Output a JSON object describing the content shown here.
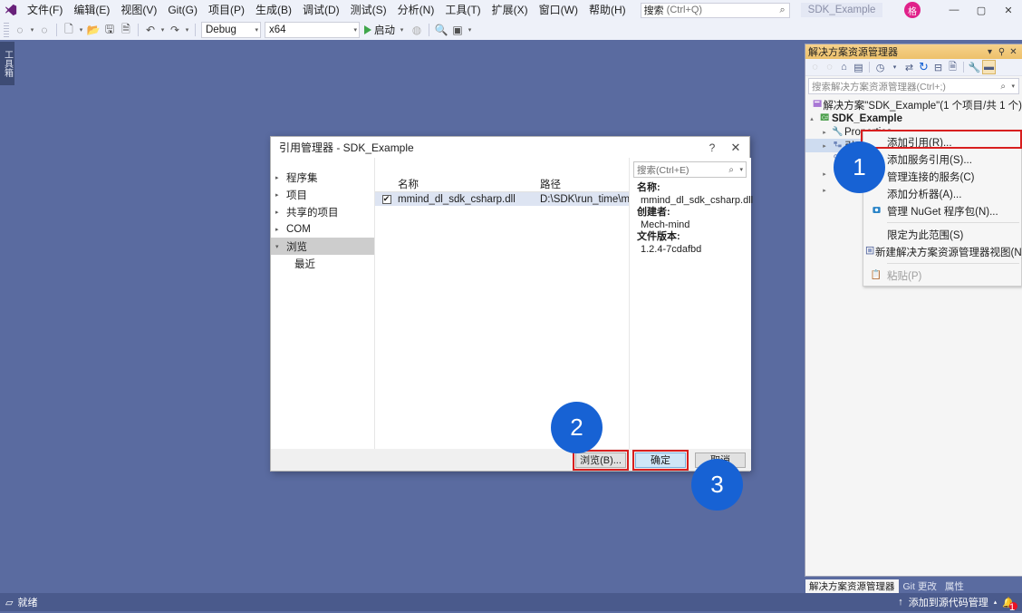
{
  "app": {
    "logo": "vs-logo",
    "menus": [
      "文件(F)",
      "编辑(E)",
      "视图(V)",
      "Git(G)",
      "项目(P)",
      "生成(B)",
      "调试(D)",
      "测试(S)",
      "分析(N)",
      "工具(T)",
      "扩展(X)",
      "窗口(W)",
      "帮助(H)"
    ],
    "quick_search": {
      "label": "搜索",
      "hint": "(Ctrl+Q)"
    },
    "project_chip": "SDK_Example",
    "account_initial": "格",
    "window_buttons": {
      "minimize": "—",
      "maximize": "▢",
      "close": "✕"
    }
  },
  "toolbar": {
    "config": {
      "value": "Debug"
    },
    "platform": {
      "value": "x64"
    },
    "run_label": "启动"
  },
  "toolbox_tab": "工具箱",
  "solution_explorer": {
    "title": "解决方案资源管理器",
    "title_buttons": {
      "dropdown": "▾",
      "pin": "⚲",
      "close": "✕"
    },
    "search": {
      "placeholder": "搜索解决方案资源管理器(Ctrl+;)"
    },
    "tree": [
      {
        "label": "解决方案\"SDK_Example\"(1 个项目/共 1 个)",
        "indent": 0,
        "arrow": "",
        "icon": "solution-icon",
        "bold": false,
        "selected": false
      },
      {
        "label": "SDK_Example",
        "indent": 1,
        "arrow": "▴",
        "icon": "csproj-icon",
        "bold": true,
        "selected": false
      },
      {
        "label": "Properties",
        "indent": 2,
        "arrow": "▸",
        "icon": "properties-icon",
        "bold": false,
        "selected": false
      },
      {
        "label": "引用",
        "indent": 2,
        "arrow": "▸",
        "icon": "references-icon",
        "bold": false,
        "selected": true
      },
      {
        "label": "",
        "indent": 2,
        "arrow": "",
        "icon": "dependency-icon",
        "bold": false,
        "selected": false
      },
      {
        "label": "",
        "indent": 2,
        "arrow": "▸",
        "icon": "",
        "bold": false,
        "selected": false
      },
      {
        "label": "",
        "indent": 2,
        "arrow": "▸",
        "icon": "",
        "bold": false,
        "selected": false
      }
    ]
  },
  "context_menu": {
    "items": [
      {
        "label": "添加引用(R)...",
        "icon": "",
        "disabled": false,
        "sep_before": false
      },
      {
        "label": "添加服务引用(S)...",
        "icon": "",
        "disabled": false,
        "sep_before": false
      },
      {
        "label": "管理连接的服务(C)",
        "icon": "",
        "disabled": false,
        "sep_before": false
      },
      {
        "label": "添加分析器(A)...",
        "icon": "",
        "disabled": false,
        "sep_before": false
      },
      {
        "label": "管理 NuGet 程序包(N)...",
        "icon": "nuget-icon",
        "disabled": false,
        "sep_before": false
      },
      {
        "label": "限定为此范围(S)",
        "icon": "",
        "disabled": false,
        "sep_before": true
      },
      {
        "label": "新建解决方案资源管理器视图(N)",
        "icon": "new-view-icon",
        "disabled": false,
        "sep_before": false
      },
      {
        "label": "粘贴(P)",
        "icon": "paste-icon",
        "disabled": true,
        "sep_before": true
      }
    ]
  },
  "reference_dialog": {
    "title": "引用管理器 - SDK_Example",
    "help_button": "?",
    "close_button": "✕",
    "categories": [
      {
        "label": "程序集",
        "arrow": "▸",
        "selected": false,
        "sub": false
      },
      {
        "label": "项目",
        "arrow": "▸",
        "selected": false,
        "sub": false
      },
      {
        "label": "共享的项目",
        "arrow": "▸",
        "selected": false,
        "sub": false
      },
      {
        "label": "COM",
        "arrow": "▸",
        "selected": false,
        "sub": false
      },
      {
        "label": "浏览",
        "arrow": "▾",
        "selected": true,
        "sub": false
      },
      {
        "label": "最近",
        "arrow": "",
        "selected": false,
        "sub": true
      }
    ],
    "search": {
      "placeholder": "搜索(Ctrl+E)"
    },
    "columns": [
      "",
      "名称",
      "路径"
    ],
    "rows": [
      {
        "checked": true,
        "check_glyph": "✔",
        "name": "mmind_dl_sdk_csharp.dll",
        "path": "D:\\SDK\\run_time\\m..."
      }
    ],
    "details": [
      {
        "key": "名称:",
        "value": "mmind_dl_sdk_csharp.dll"
      },
      {
        "key": "创建者:",
        "value": "Mech-mind"
      },
      {
        "key": "文件版本:",
        "value": "1.2.4-7cdafbd"
      }
    ],
    "buttons": {
      "browse": "浏览(B)...",
      "ok": "确定",
      "cancel": "取消"
    }
  },
  "step_badges": [
    {
      "number": "1"
    },
    {
      "number": "2"
    },
    {
      "number": "3"
    }
  ],
  "bottom_tabs": [
    {
      "label": "解决方案资源管理器",
      "active": true
    },
    {
      "label": "Git 更改",
      "active": false
    },
    {
      "label": "属性",
      "active": false
    }
  ],
  "status_bar": {
    "state": "就绪",
    "source_control": "添加到源代码管理",
    "notify_count": "1"
  },
  "colors": {
    "badge_blue": "#1762d4",
    "highlight_red": "#d81f1f",
    "accent_gold": "#f0c674",
    "chrome_bg": "#5a6ba0"
  }
}
